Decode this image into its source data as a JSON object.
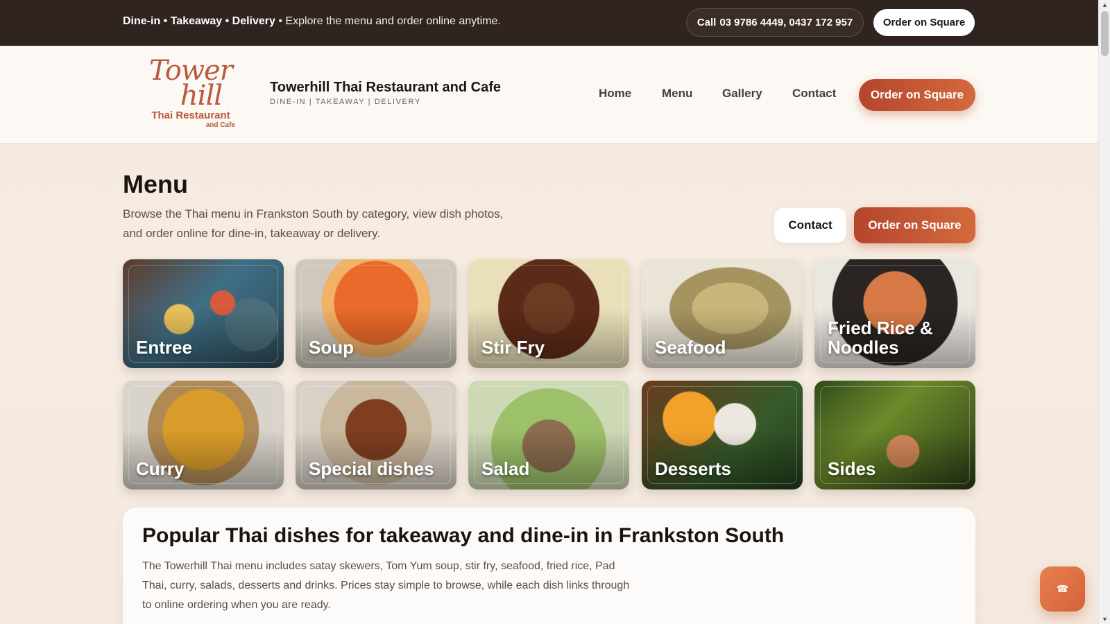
{
  "topbar": {
    "service_dinein": "Dine-in",
    "sep1": " • ",
    "service_takeaway": "Takeaway",
    "sep2": " • ",
    "service_delivery": "Delivery",
    "tagline": " • Explore the menu and order online anytime.",
    "call_label": "Call",
    "call_numbers": "03 9786 4449, 0437 172 957",
    "order_label": "Order on Square"
  },
  "header": {
    "logo_line1": "Tower",
    "logo_line2": "hill",
    "logo_line3": "Thai Restaurant",
    "logo_line4": "and Cafe",
    "brand_name": "Towerhill Thai Restaurant and Cafe",
    "brand_tagline": "DINE-IN | TAKEAWAY | DELIVERY",
    "nav": [
      "Home",
      "Menu",
      "Gallery",
      "Contact"
    ],
    "order_label": "Order on Square"
  },
  "menu": {
    "title": "Menu",
    "intro": "Browse the Thai menu in Frankston South by category, view dish photos, and order online for dine-in, takeaway or delivery.",
    "contact_label": "Contact",
    "order_label": "Order on Square",
    "categories": [
      "Entree",
      "Soup",
      "Stir Fry",
      "Seafood",
      "Fried Rice & Noodles",
      "Curry",
      "Special dishes",
      "Salad",
      "Desserts",
      "Sides"
    ]
  },
  "popular": {
    "heading": "Popular Thai dishes for takeaway and dine-in in Frankston South",
    "body": "The Towerhill Thai menu includes satay skewers, Tom Yum soup, stir fry, seafood, fried rice, Pad Thai, curry, salads, desserts and drinks. Prices stay simple to browse, while each dish links through to online ordering when you are ready."
  },
  "fab": {
    "icon": "phone-icon",
    "glyph": "☎"
  },
  "colors": {
    "topbar_bg": "#2f2420",
    "accent_orange": "#c9593a",
    "brand_logo": "#b9593d"
  }
}
